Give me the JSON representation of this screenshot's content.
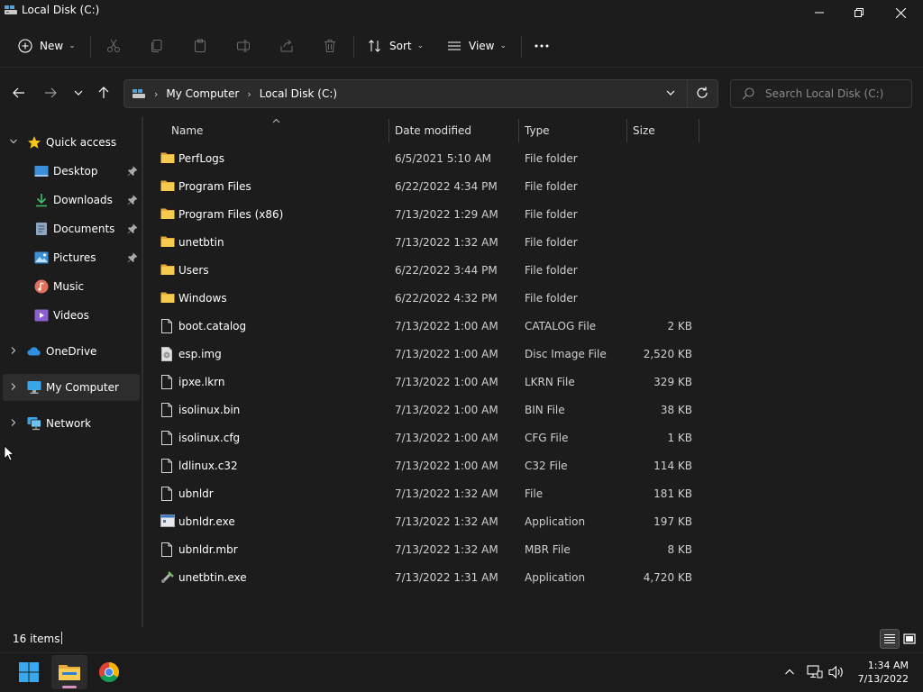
{
  "window": {
    "title": "Local Disk (C:)"
  },
  "commandbar": {
    "new_label": "New",
    "sort_label": "Sort",
    "view_label": "View"
  },
  "address": {
    "crumbs": [
      "My Computer",
      "Local Disk (C:)"
    ],
    "search_placeholder": "Search Local Disk (C:)"
  },
  "sidebar": {
    "quick_access": "Quick access",
    "items": [
      {
        "label": "Desktop",
        "icon": "desktop-icon",
        "pinned": true
      },
      {
        "label": "Downloads",
        "icon": "downloads-icon",
        "pinned": true
      },
      {
        "label": "Documents",
        "icon": "documents-icon",
        "pinned": true
      },
      {
        "label": "Pictures",
        "icon": "pictures-icon",
        "pinned": true
      },
      {
        "label": "Music",
        "icon": "music-icon",
        "pinned": false
      },
      {
        "label": "Videos",
        "icon": "videos-icon",
        "pinned": false
      }
    ],
    "onedrive": "OneDrive",
    "my_computer": "My Computer",
    "network": "Network"
  },
  "columns": {
    "name": "Name",
    "date": "Date modified",
    "type": "Type",
    "size": "Size"
  },
  "files": [
    {
      "name": "PerfLogs",
      "date": "6/5/2021 5:10 AM",
      "type": "File folder",
      "size": "",
      "icon": "folder"
    },
    {
      "name": "Program Files",
      "date": "6/22/2022 4:34 PM",
      "type": "File folder",
      "size": "",
      "icon": "folder"
    },
    {
      "name": "Program Files (x86)",
      "date": "7/13/2022 1:29 AM",
      "type": "File folder",
      "size": "",
      "icon": "folder"
    },
    {
      "name": "unetbtin",
      "date": "7/13/2022 1:32 AM",
      "type": "File folder",
      "size": "",
      "icon": "folder"
    },
    {
      "name": "Users",
      "date": "6/22/2022 3:44 PM",
      "type": "File folder",
      "size": "",
      "icon": "folder"
    },
    {
      "name": "Windows",
      "date": "6/22/2022 4:32 PM",
      "type": "File folder",
      "size": "",
      "icon": "folder"
    },
    {
      "name": "boot.catalog",
      "date": "7/13/2022 1:00 AM",
      "type": "CATALOG File",
      "size": "2 KB",
      "icon": "file"
    },
    {
      "name": "esp.img",
      "date": "7/13/2022 1:00 AM",
      "type": "Disc Image File",
      "size": "2,520 KB",
      "icon": "disc"
    },
    {
      "name": "ipxe.lkrn",
      "date": "7/13/2022 1:00 AM",
      "type": "LKRN File",
      "size": "329 KB",
      "icon": "file"
    },
    {
      "name": "isolinux.bin",
      "date": "7/13/2022 1:00 AM",
      "type": "BIN File",
      "size": "38 KB",
      "icon": "file"
    },
    {
      "name": "isolinux.cfg",
      "date": "7/13/2022 1:00 AM",
      "type": "CFG File",
      "size": "1 KB",
      "icon": "file"
    },
    {
      "name": "ldlinux.c32",
      "date": "7/13/2022 1:00 AM",
      "type": "C32 File",
      "size": "114 KB",
      "icon": "file"
    },
    {
      "name": "ubnldr",
      "date": "7/13/2022 1:32 AM",
      "type": "File",
      "size": "181 KB",
      "icon": "file"
    },
    {
      "name": "ubnldr.exe",
      "date": "7/13/2022 1:32 AM",
      "type": "Application",
      "size": "197 KB",
      "icon": "exe"
    },
    {
      "name": "ubnldr.mbr",
      "date": "7/13/2022 1:32 AM",
      "type": "MBR File",
      "size": "8 KB",
      "icon": "file"
    },
    {
      "name": "unetbtin.exe",
      "date": "7/13/2022 1:31 AM",
      "type": "Application",
      "size": "4,720 KB",
      "icon": "unetbootin"
    }
  ],
  "status": {
    "count": "16 items"
  },
  "taskbar": {
    "time": "1:34 AM",
    "date": "7/13/2022"
  },
  "colors": {
    "background": "#1c1c1c",
    "folder": "#f4c54d",
    "accent": "#4cc2ff",
    "indicator": "#d791c4"
  }
}
